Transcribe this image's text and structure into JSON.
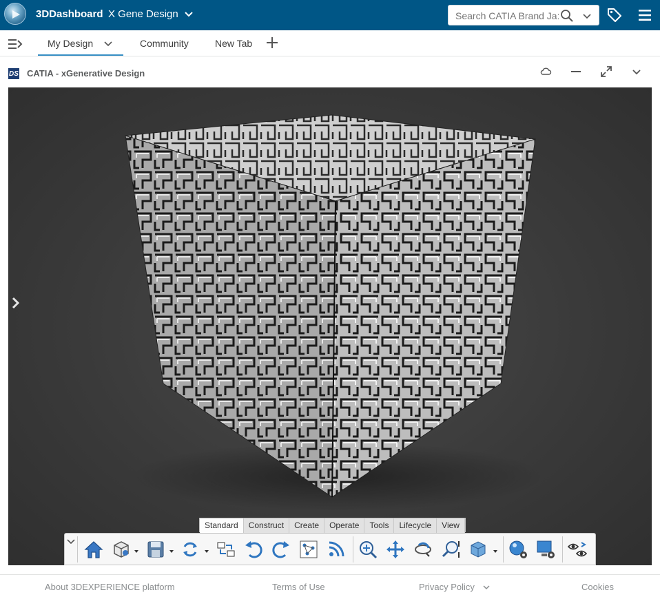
{
  "topbar": {
    "brand": "3DDashboard",
    "dashboard_name": "X Gene Design",
    "search_placeholder": "Search CATIA Brand Ja:"
  },
  "tabs": [
    {
      "label": "My Design",
      "active": true
    },
    {
      "label": "Community",
      "active": false
    },
    {
      "label": "New Tab",
      "active": false
    }
  ],
  "widget": {
    "logo_text": "DS",
    "title": "CATIA - xGenerative Design"
  },
  "action_bar": {
    "sections": [
      {
        "label": "Standard",
        "active": true
      },
      {
        "label": "Construct",
        "active": false
      },
      {
        "label": "Create",
        "active": false
      },
      {
        "label": "Operate",
        "active": false
      },
      {
        "label": "Tools",
        "active": false
      },
      {
        "label": "Lifecycle",
        "active": false
      },
      {
        "label": "View",
        "active": false
      }
    ],
    "commands": [
      "home-icon",
      "part-icon",
      "save-icon",
      "refresh-icon",
      "compare-icon",
      "undo-icon",
      "redo-icon",
      "graph-icon",
      "feed-icon",
      "zoom-fit-icon",
      "pan-icon",
      "rotate-icon",
      "zoom-icon",
      "cube-view-icon",
      "render-settings-icon",
      "display-settings-icon",
      "visibility-swap-icon"
    ]
  },
  "footer": {
    "about": "About 3DEXPERIENCE platform",
    "terms": "Terms of Use",
    "privacy": "Privacy Policy",
    "cookies": "Cookies"
  },
  "colors": {
    "topbar": "#005686",
    "accent": "#368ec4",
    "viewport": "#3a3a3a"
  }
}
